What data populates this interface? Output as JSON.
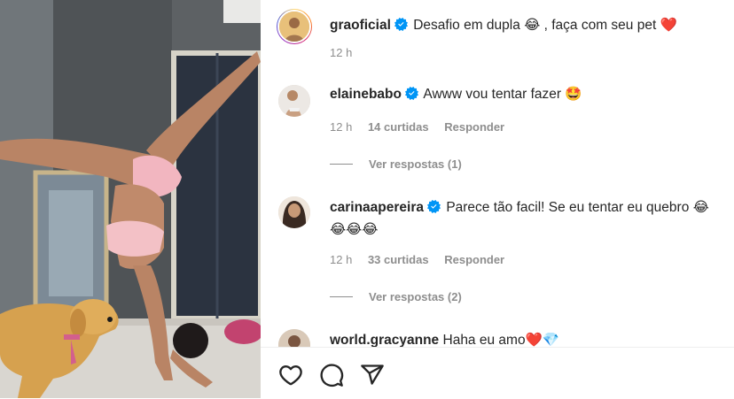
{
  "post": {
    "author": "graoficial",
    "caption_prefix": "Desafio em dupla",
    "caption_emoji_1": "😂",
    "caption_middle": " , faça com seu pet ",
    "caption_emoji_2": "❤️",
    "time": "12 h"
  },
  "comments": [
    {
      "username": "elainebabo",
      "verified": true,
      "text": "Awww vou tentar fazer ",
      "emoji": "🤩",
      "time": "12 h",
      "likes": "14 curtidas",
      "reply_label": "Responder",
      "view_replies": "Ver respostas (1)"
    },
    {
      "username": "carinaapereira",
      "verified": true,
      "text": "Parece tão facil! Se eu tentar eu quebro ",
      "emoji": "😂",
      "emoji_line2": "😂😂😂",
      "time": "12 h",
      "likes": "33 curtidas",
      "reply_label": "Responder",
      "view_replies": "Ver respostas (2)"
    },
    {
      "username": "world.gracyanne",
      "verified": false,
      "text": "Haha eu amo",
      "emoji": "❤️💎"
    }
  ],
  "icons": {
    "like": "heart-outline-icon",
    "comment": "speech-bubble-icon",
    "share": "paper-plane-icon",
    "verified": "verified-badge-icon"
  },
  "colors": {
    "verified_blue": "#0095f6",
    "muted_text": "#8e8e8e",
    "primary_text": "#262626"
  }
}
